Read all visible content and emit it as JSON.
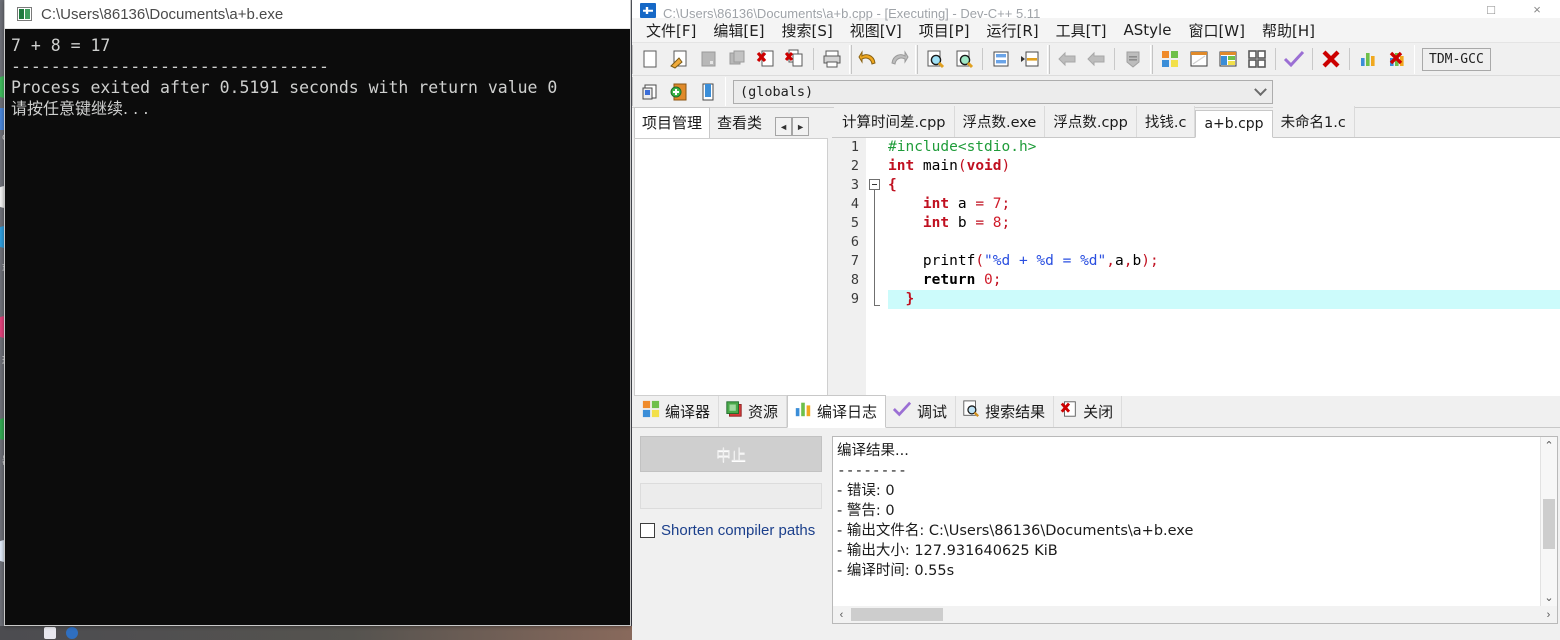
{
  "console_window": {
    "title": "C:\\Users\\86136\\Documents\\a+b.exe",
    "icon": "cmd-icon",
    "output_line1": "7 + 8 = 17",
    "output_line2": "--------------------------------",
    "output_line3": "Process exited after 0.5191 seconds with return value 0",
    "output_line4": "请按任意键继续. . ."
  },
  "dev_window": {
    "title": "C:\\Users\\86136\\Documents\\a+b.cpp - [Executing] - Dev-C++ 5.11",
    "icon": "devcpp-icon",
    "window_buttons": {
      "maximize": "□",
      "close": "×"
    },
    "menu": [
      {
        "label": "文件[F]",
        "name": "menu-file"
      },
      {
        "label": "编辑[E]",
        "name": "menu-edit"
      },
      {
        "label": "搜索[S]",
        "name": "menu-search"
      },
      {
        "label": "视图[V]",
        "name": "menu-view"
      },
      {
        "label": "项目[P]",
        "name": "menu-project"
      },
      {
        "label": "运行[R]",
        "name": "menu-run"
      },
      {
        "label": "工具[T]",
        "name": "menu-tools"
      },
      {
        "label": "AStyle",
        "name": "menu-astyle"
      },
      {
        "label": "窗口[W]",
        "name": "menu-window"
      },
      {
        "label": "帮助[H]",
        "name": "menu-help"
      }
    ],
    "toolbar": {
      "compiler_select": "TDM-GCC",
      "buttons": [
        "new-file-icon",
        "open-file-icon",
        "save-file-icon",
        "save-all-icon",
        "close-file-icon",
        "close-all-icon",
        "print-icon",
        "undo-icon",
        "redo-icon",
        "find-icon",
        "replace-icon",
        "goto-line-icon",
        "goto-function-icon",
        "back-icon",
        "forward-icon",
        "toggle-icon",
        "compile-icon",
        "run-icon",
        "compile-run-icon",
        "rebuild-all-icon",
        "syntax-check-icon",
        "stop-execution-icon",
        "profile-icon",
        "delete-profile-icon"
      ]
    },
    "toolbar2": {
      "buttons": [
        "insert-icon",
        "toggle-breakpoint-icon",
        "goto-declaration-icon"
      ],
      "globals_combo_value": "(globals)"
    },
    "left_panel": {
      "tabs": [
        {
          "label": "项目管理",
          "active": true
        },
        {
          "label": "查看类",
          "active": false
        }
      ],
      "scroll_left": "◄",
      "scroll_right": "►"
    },
    "editor_tabs": [
      {
        "label": "计算时间差.cpp",
        "active": false
      },
      {
        "label": "浮点数.exe",
        "active": false
      },
      {
        "label": "浮点数.cpp",
        "active": false
      },
      {
        "label": "找钱.c",
        "active": false
      },
      {
        "label": "a+b.cpp",
        "active": true
      },
      {
        "label": "未命名1.c",
        "active": false
      }
    ],
    "code": [
      {
        "n": "1",
        "tokens": [
          {
            "t": "#include<stdio.h>",
            "c": "k-pre"
          }
        ]
      },
      {
        "n": "2",
        "tokens": [
          {
            "t": "int",
            "c": "k-type"
          },
          {
            "t": " main",
            "c": "k-fn"
          },
          {
            "t": "(",
            "c": "k-punc"
          },
          {
            "t": "void",
            "c": "k-type"
          },
          {
            "t": ")",
            "c": "k-punc"
          }
        ]
      },
      {
        "n": "3",
        "tokens": [
          {
            "t": "{",
            "c": "k-br"
          }
        ]
      },
      {
        "n": "4",
        "tokens": [
          {
            "t": "    ",
            "c": "k-fn"
          },
          {
            "t": "int",
            "c": "k-type"
          },
          {
            "t": " a ",
            "c": "k-fn"
          },
          {
            "t": "=",
            "c": "k-punc"
          },
          {
            "t": " ",
            "c": "k-fn"
          },
          {
            "t": "7",
            "c": "k-num"
          },
          {
            "t": ";",
            "c": "k-punc"
          }
        ]
      },
      {
        "n": "5",
        "tokens": [
          {
            "t": "    ",
            "c": "k-fn"
          },
          {
            "t": "int",
            "c": "k-type"
          },
          {
            "t": " b ",
            "c": "k-fn"
          },
          {
            "t": "=",
            "c": "k-punc"
          },
          {
            "t": " ",
            "c": "k-fn"
          },
          {
            "t": "8",
            "c": "k-num"
          },
          {
            "t": ";",
            "c": "k-punc"
          }
        ]
      },
      {
        "n": "6",
        "tokens": [
          {
            "t": "",
            "c": "k-fn"
          }
        ]
      },
      {
        "n": "7",
        "tokens": [
          {
            "t": "    printf",
            "c": "k-fn"
          },
          {
            "t": "(",
            "c": "k-punc"
          },
          {
            "t": "\"%d + %d = %d\"",
            "c": "k-str"
          },
          {
            "t": ",",
            "c": "k-punc"
          },
          {
            "t": "a",
            "c": "k-fn"
          },
          {
            "t": ",",
            "c": "k-punc"
          },
          {
            "t": "b",
            "c": "k-fn"
          },
          {
            "t": ")",
            "c": "k-punc"
          },
          {
            "t": ";",
            "c": "k-punc"
          }
        ]
      },
      {
        "n": "8",
        "tokens": [
          {
            "t": "    ",
            "c": "k-fn"
          },
          {
            "t": "return",
            "c": "k-kw"
          },
          {
            "t": " ",
            "c": "k-fn"
          },
          {
            "t": "0",
            "c": "k-num"
          },
          {
            "t": ";",
            "c": "k-punc"
          }
        ]
      },
      {
        "n": "9",
        "tokens": [
          {
            "t": "  }",
            "c": "k-br"
          }
        ],
        "highlight": true
      }
    ],
    "bottom_tabs": [
      {
        "label": "编译器",
        "icon": "compiler-icon",
        "active": false
      },
      {
        "label": "资源",
        "icon": "resource-icon",
        "active": false
      },
      {
        "label": "编译日志",
        "icon": "log-icon",
        "active": true
      },
      {
        "label": "调试",
        "icon": "debug-check-icon",
        "active": false
      },
      {
        "label": "搜索结果",
        "icon": "search-results-icon",
        "active": false
      },
      {
        "label": "关闭",
        "icon": "close-x-icon",
        "active": false
      }
    ],
    "bottom_panel": {
      "abort_button": "中止",
      "shorten_paths_label": "Shorten compiler paths",
      "shorten_paths_checked": false,
      "log_lines": [
        "编译结果...",
        "--------",
        "- 错误: 0",
        "- 警告: 0",
        "- 输出文件名: C:\\Users\\86136\\Documents\\a+b.exe",
        "- 输出大小: 127.931640625 KiB",
        "- 编译时间: 0.55s"
      ]
    },
    "scrollbars": {
      "up_arrow": "⌃",
      "down_arrow": "⌄",
      "left_arrow": "‹",
      "right_arrow": "›"
    }
  },
  "colors": {
    "accent_blue": "#1668c6",
    "console_bg": "#0c0c0c",
    "console_fg": "#cfd0cf",
    "highlight_line": "#ccfbfb",
    "keyword_red": "#c01020",
    "string_blue": "#2a4fe0",
    "preproc_green": "#1f9c3a",
    "link_blue": "#1b3f8b"
  }
}
